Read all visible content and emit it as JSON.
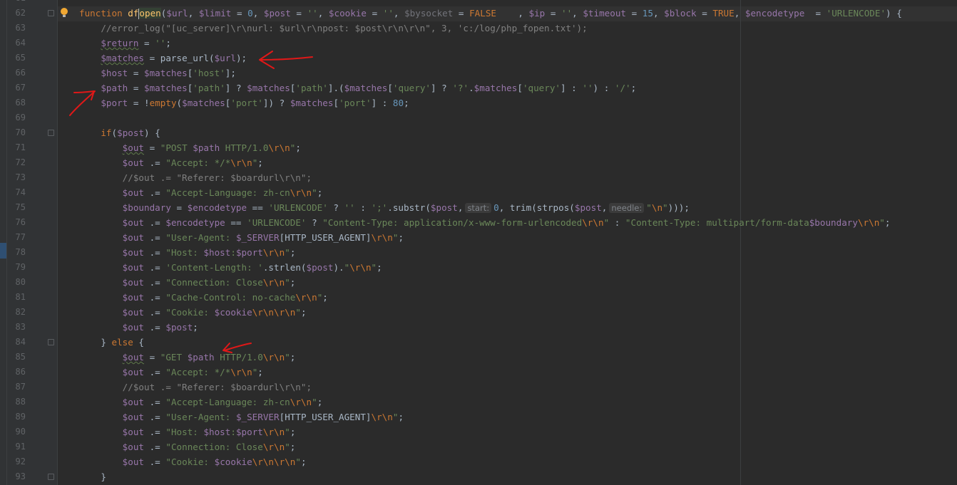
{
  "editor": {
    "first_line_number": 62,
    "lines": [
      [
        [
          "kw",
          "function "
        ],
        [
          "fn",
          "df"
        ],
        [
          "caret",
          ""
        ],
        [
          "fnhl",
          "open"
        ],
        [
          "p",
          "("
        ],
        [
          "var",
          "$url"
        ],
        [
          "p",
          ", "
        ],
        [
          "var",
          "$limit"
        ],
        [
          "p",
          " = "
        ],
        [
          "num",
          "0"
        ],
        [
          "p",
          ", "
        ],
        [
          "var",
          "$post"
        ],
        [
          "p",
          " = "
        ],
        [
          "str",
          "''"
        ],
        [
          "p",
          ", "
        ],
        [
          "var",
          "$cookie"
        ],
        [
          "p",
          " = "
        ],
        [
          "str",
          "''"
        ],
        [
          "p",
          ", "
        ],
        [
          "dimvar",
          "$bysocket"
        ],
        [
          "p",
          " = "
        ],
        [
          "kw",
          "FALSE"
        ],
        [
          "p",
          "    , "
        ],
        [
          "var",
          "$ip"
        ],
        [
          "p",
          " = "
        ],
        [
          "str",
          "''"
        ],
        [
          "p",
          ", "
        ],
        [
          "var",
          "$timeout"
        ],
        [
          "p",
          " = "
        ],
        [
          "num",
          "15"
        ],
        [
          "p",
          ", "
        ],
        [
          "var",
          "$block"
        ],
        [
          "p",
          " = "
        ],
        [
          "kw",
          "TRUE"
        ],
        [
          "p",
          ", "
        ],
        [
          "var",
          "$encodetype"
        ],
        [
          "p",
          "  = "
        ],
        [
          "str",
          "'URLENCODE'"
        ],
        [
          "p",
          ") {"
        ]
      ],
      [
        [
          "cmt",
          "    //error_log(\"[uc_server]\\r\\nurl: $url\\r\\npost: $post\\r\\n\\r\\n\", 3, 'c:/log/php_fopen.txt');"
        ]
      ],
      [
        [
          "p",
          "    "
        ],
        [
          "var",
          "$return"
        ],
        [
          "p",
          " = "
        ],
        [
          "str",
          "''"
        ],
        [
          "p",
          ";"
        ]
      ],
      [
        [
          "p",
          "    "
        ],
        [
          "var",
          "$matches"
        ],
        [
          "p",
          " = parse_url("
        ],
        [
          "var",
          "$url"
        ],
        [
          "p",
          ");"
        ]
      ],
      [
        [
          "p",
          "    "
        ],
        [
          "var",
          "$host"
        ],
        [
          "p",
          " = "
        ],
        [
          "var",
          "$matches"
        ],
        [
          "p",
          "["
        ],
        [
          "str",
          "'host'"
        ],
        [
          "p",
          "];"
        ]
      ],
      [
        [
          "p",
          "    "
        ],
        [
          "var",
          "$path"
        ],
        [
          "p",
          " = "
        ],
        [
          "var",
          "$matches"
        ],
        [
          "p",
          "["
        ],
        [
          "str",
          "'path'"
        ],
        [
          "p",
          "] ? "
        ],
        [
          "var",
          "$matches"
        ],
        [
          "p",
          "["
        ],
        [
          "str",
          "'path'"
        ],
        [
          "p",
          "].("
        ],
        [
          "var",
          "$matches"
        ],
        [
          "p",
          "["
        ],
        [
          "str",
          "'query'"
        ],
        [
          "p",
          "] ? "
        ],
        [
          "str",
          "'?'"
        ],
        [
          "p",
          "."
        ],
        [
          "var",
          "$matches"
        ],
        [
          "p",
          "["
        ],
        [
          "str",
          "'query'"
        ],
        [
          "p",
          "] : "
        ],
        [
          "str",
          "''"
        ],
        [
          "p",
          ") : "
        ],
        [
          "str",
          "'/'"
        ],
        [
          "p",
          ";"
        ]
      ],
      [
        [
          "p",
          "    "
        ],
        [
          "var",
          "$port"
        ],
        [
          "p",
          " = !"
        ],
        [
          "kw",
          "empty"
        ],
        [
          "p",
          "("
        ],
        [
          "var",
          "$matches"
        ],
        [
          "p",
          "["
        ],
        [
          "str",
          "'port'"
        ],
        [
          "p",
          "]) ? "
        ],
        [
          "var",
          "$matches"
        ],
        [
          "p",
          "["
        ],
        [
          "str",
          "'port'"
        ],
        [
          "p",
          "] : "
        ],
        [
          "num",
          "80"
        ],
        [
          "p",
          ";"
        ]
      ],
      [],
      [
        [
          "p",
          "    "
        ],
        [
          "kw",
          "if"
        ],
        [
          "p",
          "("
        ],
        [
          "var",
          "$post"
        ],
        [
          "p",
          ") {"
        ]
      ],
      [
        [
          "p",
          "        "
        ],
        [
          "var",
          "$out"
        ],
        [
          "p",
          " = "
        ],
        [
          "str",
          "\"POST "
        ],
        [
          "var",
          "$path"
        ],
        [
          "str",
          " HTTP/1.0"
        ],
        [
          "esc",
          "\\r\\n"
        ],
        [
          "str",
          "\""
        ],
        [
          "p",
          ";"
        ]
      ],
      [
        [
          "p",
          "        "
        ],
        [
          "var",
          "$out"
        ],
        [
          "p",
          " .= "
        ],
        [
          "str",
          "\"Accept: */*"
        ],
        [
          "esc",
          "\\r\\n"
        ],
        [
          "str",
          "\""
        ],
        [
          "p",
          ";"
        ]
      ],
      [
        [
          "cmt",
          "        //$out .= \"Referer: $boardurl\\r\\n\";"
        ]
      ],
      [
        [
          "p",
          "        "
        ],
        [
          "var",
          "$out"
        ],
        [
          "p",
          " .= "
        ],
        [
          "str",
          "\"Accept-Language: zh-cn"
        ],
        [
          "esc",
          "\\r\\n"
        ],
        [
          "str",
          "\""
        ],
        [
          "p",
          ";"
        ]
      ],
      [
        [
          "p",
          "        "
        ],
        [
          "var",
          "$boundary"
        ],
        [
          "p",
          " = "
        ],
        [
          "var",
          "$encodetype"
        ],
        [
          "p",
          " == "
        ],
        [
          "str",
          "'URLENCODE'"
        ],
        [
          "p",
          " ? "
        ],
        [
          "str",
          "''"
        ],
        [
          "p",
          " : "
        ],
        [
          "str",
          "';'"
        ],
        [
          "p",
          ".substr("
        ],
        [
          "var",
          "$post"
        ],
        [
          "p",
          ","
        ],
        [
          "hint",
          "start:"
        ],
        [
          "num",
          "0"
        ],
        [
          "p",
          ", trim(strpos("
        ],
        [
          "var",
          "$post"
        ],
        [
          "p",
          ","
        ],
        [
          "hint",
          "needle:"
        ],
        [
          "str",
          "\""
        ],
        [
          "esc",
          "\\n"
        ],
        [
          "str",
          "\""
        ],
        [
          "p",
          ")));"
        ]
      ],
      [
        [
          "p",
          "        "
        ],
        [
          "var",
          "$out"
        ],
        [
          "p",
          " .= "
        ],
        [
          "var",
          "$encodetype"
        ],
        [
          "p",
          " == "
        ],
        [
          "str",
          "'URLENCODE'"
        ],
        [
          "p",
          " ? "
        ],
        [
          "str",
          "\"Content-Type: application/x-www-form-urlencoded"
        ],
        [
          "esc",
          "\\r\\n"
        ],
        [
          "str",
          "\""
        ],
        [
          "p",
          " : "
        ],
        [
          "str",
          "\"Content-Type: multipart/form-data"
        ],
        [
          "var",
          "$boundary"
        ],
        [
          "esc",
          "\\r\\n"
        ],
        [
          "str",
          "\""
        ],
        [
          "p",
          ";"
        ]
      ],
      [
        [
          "p",
          "        "
        ],
        [
          "var",
          "$out"
        ],
        [
          "p",
          " .= "
        ],
        [
          "str",
          "\"User-Agent: "
        ],
        [
          "var",
          "$_SERVER"
        ],
        [
          "p",
          "[HTTP_USER_AGENT]"
        ],
        [
          "esc",
          "\\r\\n"
        ],
        [
          "str",
          "\""
        ],
        [
          "p",
          ";"
        ]
      ],
      [
        [
          "p",
          "        "
        ],
        [
          "var",
          "$out"
        ],
        [
          "p",
          " .= "
        ],
        [
          "str",
          "\"Host: "
        ],
        [
          "var",
          "$host"
        ],
        [
          "str",
          ":"
        ],
        [
          "var",
          "$port"
        ],
        [
          "esc",
          "\\r\\n"
        ],
        [
          "str",
          "\""
        ],
        [
          "p",
          ";"
        ]
      ],
      [
        [
          "p",
          "        "
        ],
        [
          "var",
          "$out"
        ],
        [
          "p",
          " .= "
        ],
        [
          "str",
          "'Content-Length: '"
        ],
        [
          "p",
          ".strlen("
        ],
        [
          "var",
          "$post"
        ],
        [
          "p",
          ")."
        ],
        [
          "str",
          "\""
        ],
        [
          "esc",
          "\\r\\n"
        ],
        [
          "str",
          "\""
        ],
        [
          "p",
          ";"
        ]
      ],
      [
        [
          "p",
          "        "
        ],
        [
          "var",
          "$out"
        ],
        [
          "p",
          " .= "
        ],
        [
          "str",
          "\"Connection: Close"
        ],
        [
          "esc",
          "\\r\\n"
        ],
        [
          "str",
          "\""
        ],
        [
          "p",
          ";"
        ]
      ],
      [
        [
          "p",
          "        "
        ],
        [
          "var",
          "$out"
        ],
        [
          "p",
          " .= "
        ],
        [
          "str",
          "\"Cache-Control: no-cache"
        ],
        [
          "esc",
          "\\r\\n"
        ],
        [
          "str",
          "\""
        ],
        [
          "p",
          ";"
        ]
      ],
      [
        [
          "p",
          "        "
        ],
        [
          "var",
          "$out"
        ],
        [
          "p",
          " .= "
        ],
        [
          "str",
          "\"Cookie: "
        ],
        [
          "var",
          "$cookie"
        ],
        [
          "esc",
          "\\r\\n\\r\\n"
        ],
        [
          "str",
          "\""
        ],
        [
          "p",
          ";"
        ]
      ],
      [
        [
          "p",
          "        "
        ],
        [
          "var",
          "$out"
        ],
        [
          "p",
          " .= "
        ],
        [
          "var",
          "$post"
        ],
        [
          "p",
          ";"
        ]
      ],
      [
        [
          "p",
          "    } "
        ],
        [
          "kw",
          "else"
        ],
        [
          "p",
          " {"
        ]
      ],
      [
        [
          "p",
          "        "
        ],
        [
          "var",
          "$out"
        ],
        [
          "p",
          " = "
        ],
        [
          "str",
          "\"GET "
        ],
        [
          "var",
          "$path"
        ],
        [
          "str",
          " HTTP/1.0"
        ],
        [
          "esc",
          "\\r\\n"
        ],
        [
          "str",
          "\""
        ],
        [
          "p",
          ";"
        ]
      ],
      [
        [
          "p",
          "        "
        ],
        [
          "var",
          "$out"
        ],
        [
          "p",
          " .= "
        ],
        [
          "str",
          "\"Accept: */*"
        ],
        [
          "esc",
          "\\r\\n"
        ],
        [
          "str",
          "\""
        ],
        [
          "p",
          ";"
        ]
      ],
      [
        [
          "cmt",
          "        //$out .= \"Referer: $boardurl\\r\\n\";"
        ]
      ],
      [
        [
          "p",
          "        "
        ],
        [
          "var",
          "$out"
        ],
        [
          "p",
          " .= "
        ],
        [
          "str",
          "\"Accept-Language: zh-cn"
        ],
        [
          "esc",
          "\\r\\n"
        ],
        [
          "str",
          "\""
        ],
        [
          "p",
          ";"
        ]
      ],
      [
        [
          "p",
          "        "
        ],
        [
          "var",
          "$out"
        ],
        [
          "p",
          " .= "
        ],
        [
          "str",
          "\"User-Agent: "
        ],
        [
          "var",
          "$_SERVER"
        ],
        [
          "p",
          "[HTTP_USER_AGENT]"
        ],
        [
          "esc",
          "\\r\\n"
        ],
        [
          "str",
          "\""
        ],
        [
          "p",
          ";"
        ]
      ],
      [
        [
          "p",
          "        "
        ],
        [
          "var",
          "$out"
        ],
        [
          "p",
          " .= "
        ],
        [
          "str",
          "\"Host: "
        ],
        [
          "var",
          "$host"
        ],
        [
          "str",
          ":"
        ],
        [
          "var",
          "$port"
        ],
        [
          "esc",
          "\\r\\n"
        ],
        [
          "str",
          "\""
        ],
        [
          "p",
          ";"
        ]
      ],
      [
        [
          "p",
          "        "
        ],
        [
          "var",
          "$out"
        ],
        [
          "p",
          " .= "
        ],
        [
          "str",
          "\"Connection: Close"
        ],
        [
          "esc",
          "\\r\\n"
        ],
        [
          "str",
          "\""
        ],
        [
          "p",
          ";"
        ]
      ],
      [
        [
          "p",
          "        "
        ],
        [
          "var",
          "$out"
        ],
        [
          "p",
          " .= "
        ],
        [
          "str",
          "\"Cookie: "
        ],
        [
          "var",
          "$cookie"
        ],
        [
          "esc",
          "\\r\\n\\r\\n"
        ],
        [
          "str",
          "\""
        ],
        [
          "p",
          ";"
        ]
      ],
      [
        [
          "p",
          "    }"
        ]
      ]
    ]
  },
  "colors": {
    "background": "#2b2b2b",
    "gutter": "#313335",
    "keyword": "#cc7832",
    "variable": "#9876aa",
    "string": "#6a8759",
    "number": "#6897bb",
    "function_name": "#ffc66d",
    "comment": "#808080",
    "annotation_arrows": "#e01818"
  },
  "icons": {
    "intention_bulb": "lightbulb-icon",
    "fold_marker": "fold-marker-icon"
  }
}
